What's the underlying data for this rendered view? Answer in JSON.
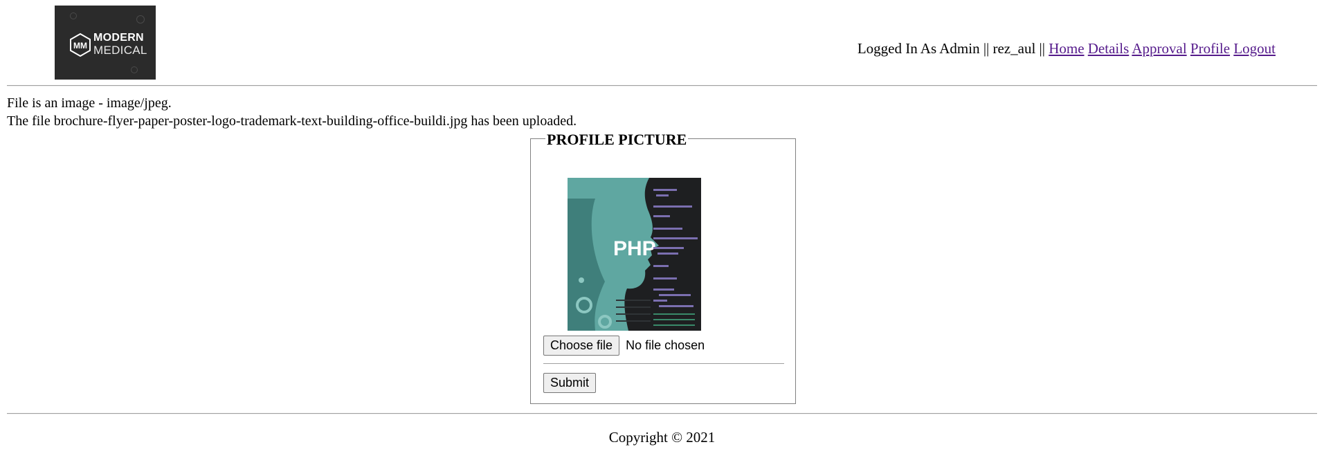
{
  "header": {
    "logo": {
      "line1": "MODERN",
      "line2": "MEDICAL",
      "monogram": "MM"
    },
    "status_text": "Logged In As Admin || rez_aul ||",
    "nav": [
      {
        "label": "Home"
      },
      {
        "label": "Details"
      },
      {
        "label": "Approval"
      },
      {
        "label": "Profile"
      },
      {
        "label": "Logout"
      }
    ]
  },
  "messages": {
    "type_line": "File is an image - image/jpeg.",
    "upload_line": "The file brochure-flyer-paper-poster-logo-trademark-text-building-office-buildi.jpg has been uploaded."
  },
  "profile_form": {
    "legend": "PROFILE PICTURE",
    "photo_text": "PHP",
    "choose_label": "Choose file",
    "no_file_text": "No file chosen",
    "submit_label": "Submit"
  },
  "footer": {
    "copyright": "Copyright © 2021"
  },
  "colors": {
    "link": "#551a8b",
    "logo_bg": "#2b2b2b",
    "photo_teal": "#5fa7a1"
  }
}
